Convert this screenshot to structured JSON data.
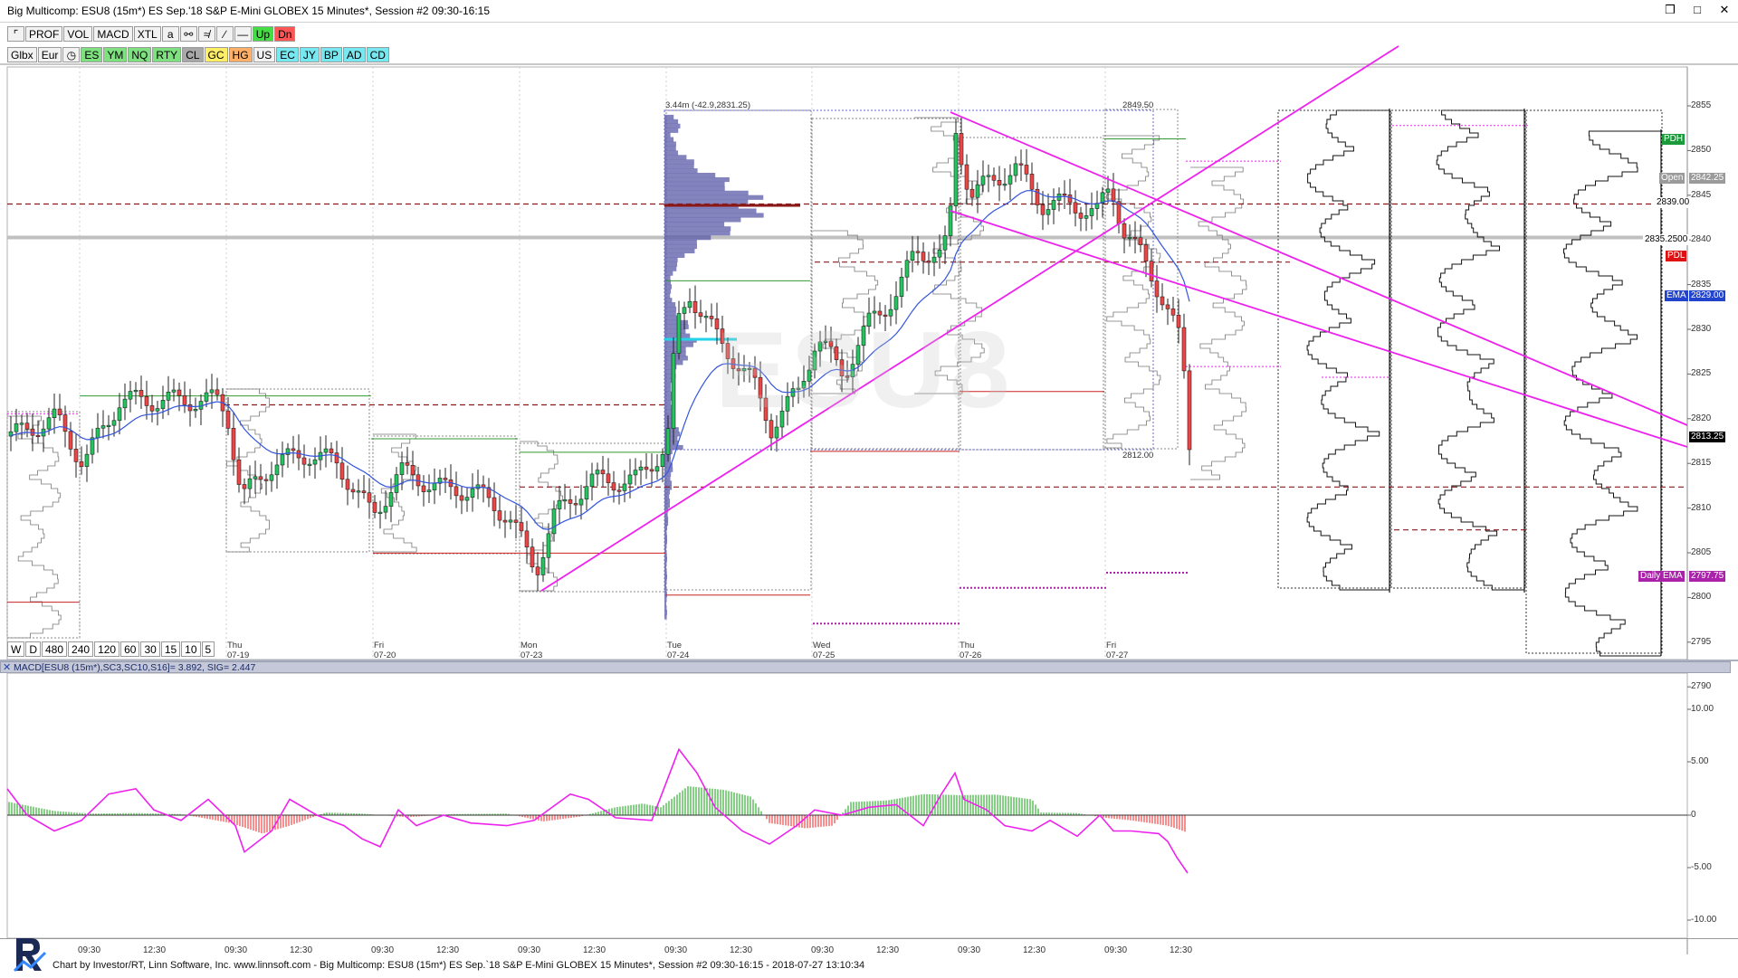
{
  "window": {
    "title": "Big Multicomp: ESU8 (15m*) ES Sep.'18 S&P E-Mini GLOBEX 15 Minutes*, Session #2 09:30-16:15",
    "controls": {
      "restore": "❒",
      "maximize": "□",
      "close": "✕"
    }
  },
  "toolbar1": {
    "items": [
      "PROF",
      "VOL",
      "MACD",
      "XTL",
      "a"
    ],
    "up": "Up",
    "dn": "Dn"
  },
  "toolbar2": {
    "items": [
      "Glbx",
      "Eur"
    ],
    "symbols": [
      {
        "label": "ES",
        "color": "green"
      },
      {
        "label": "YM",
        "color": "green"
      },
      {
        "label": "NQ",
        "color": "green"
      },
      {
        "label": "RTY",
        "color": "green"
      },
      {
        "label": "CL",
        "color": "darkgray"
      },
      {
        "label": "GC",
        "color": "yellow"
      },
      {
        "label": "HG",
        "color": "orange"
      },
      {
        "label": "US",
        "color": "none"
      },
      {
        "label": "EC",
        "color": "cyan"
      },
      {
        "label": "JY",
        "color": "cyan"
      },
      {
        "label": "BP",
        "color": "cyan"
      },
      {
        "label": "AD",
        "color": "cyan"
      },
      {
        "label": "CD",
        "color": "cyan"
      }
    ]
  },
  "timeframes": [
    "W",
    "D",
    "480",
    "240",
    "120",
    "60",
    "30",
    "15",
    "10",
    "5"
  ],
  "dates": [
    {
      "day": "Thu",
      "date": "07-19"
    },
    {
      "day": "Fri",
      "date": "07-20"
    },
    {
      "day": "Mon",
      "date": "07-23"
    },
    {
      "day": "Tue",
      "date": "07-24"
    },
    {
      "day": "Wed",
      "date": "07-25"
    },
    {
      "day": "Thu",
      "date": "07-26"
    },
    {
      "day": "Fri",
      "date": "07-27"
    }
  ],
  "price_axis": [
    "2855",
    "2850",
    "2845",
    "2840",
    "2835",
    "2830",
    "2825",
    "2820",
    "2815",
    "2810",
    "2805",
    "2800",
    "2795",
    "2790"
  ],
  "price_tags": {
    "pdh": "PDH",
    "open": "Open",
    "open_val": "2842.25",
    "price_2839": "2839.00",
    "price_2835": "2835.2500",
    "pdl": "PDL",
    "ema": "EMA",
    "ema_val": "2829.00",
    "last": "2813.25",
    "daily_ema": "Daily EMA",
    "daily_ema_val": "2797.75"
  },
  "box_labels": {
    "tl": "3.44m (-42.9,2831.25)",
    "tr": "2849.50",
    "br": "2812.00"
  },
  "watermark": "ESU8",
  "macd": {
    "header": "MACD[ESU8 (15m*),SC3,SC10,S16]=  3.892, SIG=  2.447",
    "axis": [
      "10.00",
      "5.00",
      "0",
      "-5.00",
      "-10.00"
    ]
  },
  "time_axis": [
    "09:30",
    "12:30",
    "09:30",
    "12:30",
    "09:30",
    "12:30",
    "09:30",
    "12:30",
    "09:30",
    "12:30",
    "09:30",
    "12:30",
    "09:30",
    "12:30",
    "09:30",
    "12:30"
  ],
  "status": "Chart by Investor/RT, Linn Software, Inc. www.linnsoft.com - Big Multicomp: ESU8 (15m*) ES Sep.`18 S&P E-Mini GLOBEX 15 Minutes*, Session #2 09:30-16:15 - 2018-07-27 13:10:34",
  "colors": {
    "up": "#22c55e",
    "down": "#ef4444",
    "trendline": "#ee22ee",
    "ema": "#3355dd",
    "volume_profile": "#5a5aa8"
  }
}
